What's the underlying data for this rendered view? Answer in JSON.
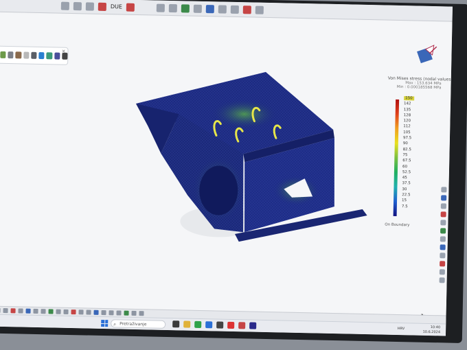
{
  "toolbar": {
    "label": "DUE",
    "icons": [
      "zoom-icon",
      "view-icon",
      "measure-icon",
      "render-icon",
      "settings-icon",
      "save-icon",
      "folder-icon",
      "print-icon"
    ]
  },
  "view_toolbar": {
    "close": "×",
    "icons": [
      "select-icon",
      "rotate-icon",
      "pan-icon",
      "zoom-icon",
      "box-icon",
      "color-icon",
      "shade-icon",
      "mesh-icon",
      "light-icon",
      "camera-icon"
    ]
  },
  "legend": {
    "title": "Von Mises stress (nodal values)",
    "max": "Max : 153.634 MPa",
    "min": "Min : 0.000185568 MPa",
    "top_value": "150",
    "ticks": [
      "142",
      "135",
      "128",
      "120",
      "112",
      "105",
      "97.5",
      "90",
      "82.5",
      "75",
      "67.5",
      "60",
      "52.5",
      "45",
      "37.5",
      "30",
      "22.5",
      "15",
      "7.5"
    ],
    "footer": "On Boundary",
    "colors": {
      "high": "#b01010",
      "mid": "#e8e020",
      "low": "#101080",
      "highlight": "#d6d23a"
    }
  },
  "model": {
    "part_color": "#1a2878",
    "load_arrow_color": "#e6e64a",
    "load_arrow_count": 4
  },
  "taskbar": {
    "search_placeholder": "Pretraživanje",
    "language": "HRV",
    "time": "10:40",
    "date": "10.6.2024"
  }
}
